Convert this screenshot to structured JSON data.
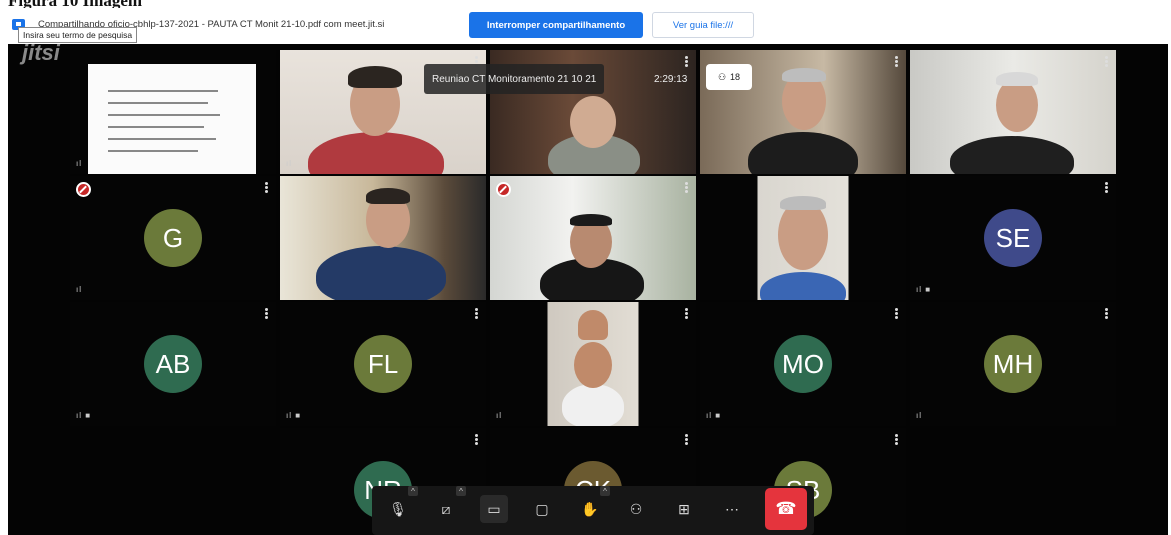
{
  "heading_partial": "Figura 10 Imagem",
  "share_bar": {
    "text": "Compartilhando oficio-cbhlp-137-2021 - PAUTA CT Monit 21-10.pdf com meet.jit.si",
    "stop_label": "Interromper compartilhamento",
    "view_label": "Ver guia file:///"
  },
  "overlay": {
    "search_tooltip": "Insira seu termo de pesquisa",
    "brand_mark": "jitsi",
    "meeting_title": "Reuniao CT Monitoramento 21 10 21",
    "timer": "2:29:13",
    "participant_count": "18"
  },
  "tiles": [
    {
      "kind": "doc"
    },
    {
      "kind": "video"
    },
    {
      "kind": "video"
    },
    {
      "kind": "video",
      "active": true
    },
    {
      "kind": "video"
    },
    {
      "kind": "avatar",
      "initials": "G",
      "color": "#6b7a3a",
      "muted": true
    },
    {
      "kind": "video"
    },
    {
      "kind": "video",
      "muted": true
    },
    {
      "kind": "video"
    },
    {
      "kind": "avatar",
      "initials": "SE",
      "color": "#3f4a8a"
    },
    {
      "kind": "avatar",
      "initials": "AB",
      "color": "#2f6b50"
    },
    {
      "kind": "avatar",
      "initials": "FL",
      "color": "#6b7a3a"
    },
    {
      "kind": "video"
    },
    {
      "kind": "avatar",
      "initials": "MO",
      "color": "#2f6b50"
    },
    {
      "kind": "avatar",
      "initials": "MH",
      "color": "#6b7a3a"
    },
    {
      "kind": "avatar",
      "initials": "NR",
      "color": "#2f6b50"
    },
    {
      "kind": "avatar",
      "initials": "CK",
      "color": "#6b5a30"
    },
    {
      "kind": "avatar",
      "initials": "SB",
      "color": "#6b7a3a"
    }
  ],
  "toolbar": {
    "buttons": [
      {
        "name": "microphone-muted-button",
        "glyph": "🎙"
      },
      {
        "name": "camera-off-button",
        "glyph": "⧄"
      },
      {
        "name": "screen-share-button",
        "glyph": "▭"
      },
      {
        "name": "chat-button",
        "glyph": "▢"
      },
      {
        "name": "raise-hand-button",
        "glyph": "✋"
      },
      {
        "name": "participants-button",
        "glyph": "⚇"
      },
      {
        "name": "tile-view-button",
        "glyph": "⊞"
      },
      {
        "name": "more-options-button",
        "glyph": "⋯"
      }
    ],
    "hangup_glyph": "☎"
  }
}
